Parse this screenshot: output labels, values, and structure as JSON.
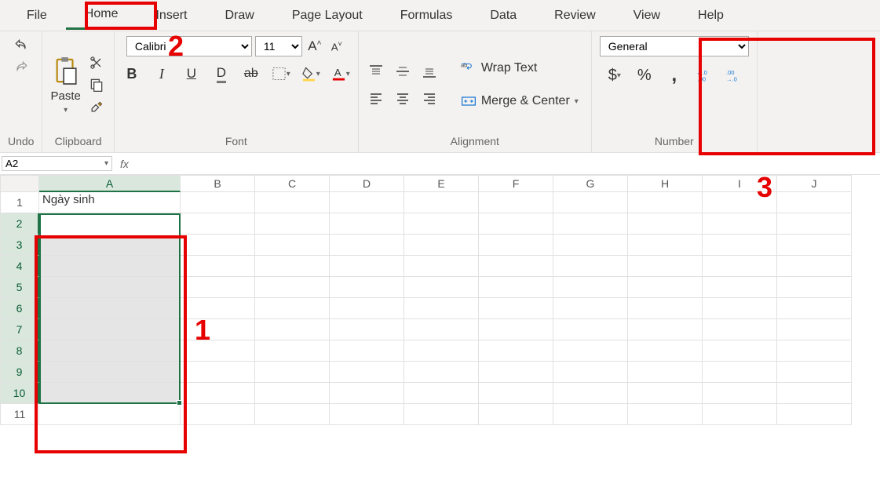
{
  "tabs": [
    "File",
    "Home",
    "Insert",
    "Draw",
    "Page Layout",
    "Formulas",
    "Data",
    "Review",
    "View",
    "Help"
  ],
  "active_tab_index": 1,
  "groups": {
    "undo": "Undo",
    "clipboard": "Clipboard",
    "font": "Font",
    "alignment": "Alignment",
    "number": "Number"
  },
  "clipboard": {
    "paste": "Paste"
  },
  "font": {
    "name": "Calibri",
    "size": "11"
  },
  "alignment": {
    "wrap": "Wrap Text",
    "merge": "Merge & Center"
  },
  "number": {
    "format": "General"
  },
  "formula": {
    "name_box": "A2",
    "fx": "fx",
    "value": ""
  },
  "columns": [
    "A",
    "B",
    "C",
    "D",
    "E",
    "F",
    "G",
    "H",
    "I",
    "J"
  ],
  "rows": [
    "1",
    "2",
    "3",
    "4",
    "5",
    "6",
    "7",
    "8",
    "9",
    "10",
    "11"
  ],
  "cells": {
    "A1": "Ngày sinh"
  },
  "selection": {
    "ref": "A2:A10",
    "active": "A2"
  },
  "annotations": {
    "a1": "1",
    "a2": "2",
    "a3": "3"
  }
}
